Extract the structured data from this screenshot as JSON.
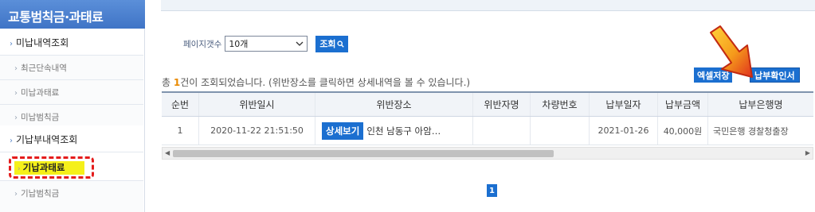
{
  "sidebar": {
    "title": "교통범칙금·과태료",
    "items": [
      {
        "label": "미납내역조회",
        "type": "main"
      },
      {
        "label": "최근단속내역",
        "type": "sub"
      },
      {
        "label": "미납과태료",
        "type": "sub"
      },
      {
        "label": "미납범칙금",
        "type": "sub"
      },
      {
        "label": "기납부내역조회",
        "type": "main"
      },
      {
        "label": "기납과태료",
        "type": "active"
      },
      {
        "label": "기납범칙금",
        "type": "sub"
      }
    ]
  },
  "search": {
    "page_count_label": "페이지갯수",
    "page_count_value": "10개",
    "query_button": "조회"
  },
  "actions": {
    "excel_button": "엑셀저장",
    "receipt_button": "납부확인서"
  },
  "result": {
    "prefix": "총 ",
    "count": "1",
    "suffix": "건이 조회되었습니다. (위반장소를 클릭하면 상세내역을 볼 수 있습니다.)"
  },
  "table": {
    "headers": [
      "순번",
      "위반일시",
      "위반장소",
      "위반자명",
      "차량번호",
      "납부일자",
      "납부금액",
      "납부은행명"
    ],
    "rows": [
      {
        "no": "1",
        "datetime": "2020-11-22 21:51:50",
        "detail_button": "상세보기",
        "location": "인천 남동구 아암…",
        "name": "",
        "car": "",
        "pay_date": "2021-01-26",
        "amount": "40,000원",
        "bank": "국민은행 경찰청출장"
      }
    ]
  },
  "pagination": {
    "current": "1"
  },
  "colors": {
    "accent": "#1b6fd0",
    "highlight": "#f5f01a",
    "annotation": "#e41c1c"
  }
}
